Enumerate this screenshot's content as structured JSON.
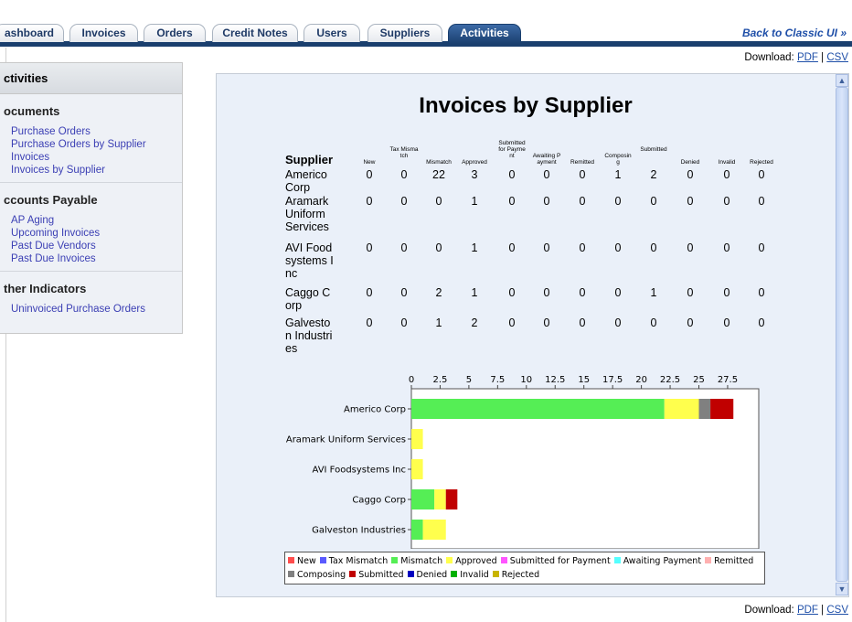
{
  "tabs": [
    {
      "label": "ashboard",
      "active": false
    },
    {
      "label": "Invoices",
      "active": false
    },
    {
      "label": "Orders",
      "active": false
    },
    {
      "label": "Credit Notes",
      "active": false
    },
    {
      "label": "Users",
      "active": false
    },
    {
      "label": "Suppliers",
      "active": false
    },
    {
      "label": "Activities",
      "active": true
    }
  ],
  "classic_link": "Back to Classic UI »",
  "download": {
    "label": "Download:",
    "pdf": "PDF",
    "separator": "|",
    "csv": "CSV"
  },
  "sidebar": {
    "header": "ctivities",
    "sections": [
      {
        "title": "ocuments",
        "links": [
          "Purchase Orders",
          "Purchase Orders by Supplier",
          "Invoices",
          "Invoices by Supplier"
        ]
      },
      {
        "title": "ccounts Payable",
        "links": [
          "AP Aging",
          "Upcoming Invoices",
          "Past Due Vendors",
          "Past Due Invoices"
        ]
      },
      {
        "title": "ther Indicators",
        "links": [
          "Uninvoiced Purchase Orders"
        ]
      }
    ]
  },
  "report": {
    "title": "Invoices by Supplier",
    "supplier_header": "Supplier",
    "columns": [
      "New",
      "Tax Mismatch",
      "Mismatch",
      "Approved",
      "Submitted for Payment",
      "Awaiting Payment",
      "Remitted",
      "Composing",
      "Submitted",
      "Denied",
      "Invalid",
      "Rejected"
    ],
    "rows": [
      {
        "supplier": "Americo Corp",
        "values": [
          0,
          0,
          22,
          3,
          0,
          0,
          0,
          1,
          2,
          0,
          0,
          0
        ]
      },
      {
        "supplier": "Aramark Uniform Services",
        "values": [
          0,
          0,
          0,
          1,
          0,
          0,
          0,
          0,
          0,
          0,
          0,
          0
        ]
      },
      {
        "supplier": "AVI Foodsystems Inc",
        "values": [
          0,
          0,
          0,
          1,
          0,
          0,
          0,
          0,
          0,
          0,
          0,
          0
        ]
      },
      {
        "supplier": "Caggo Corp",
        "values": [
          0,
          0,
          2,
          1,
          0,
          0,
          0,
          0,
          1,
          0,
          0,
          0
        ]
      },
      {
        "supplier": "Galveston Industries",
        "values": [
          0,
          0,
          1,
          2,
          0,
          0,
          0,
          0,
          0,
          0,
          0,
          0
        ]
      }
    ]
  },
  "chart_data": {
    "type": "bar",
    "orientation": "horizontal",
    "stacked": true,
    "categories": [
      "Americo Corp",
      "Aramark Uniform Services",
      "AVI Foodsystems Inc",
      "Caggo Corp",
      "Galveston Industries"
    ],
    "series": [
      {
        "name": "New",
        "color": "#ff4d4d",
        "values": [
          0,
          0,
          0,
          0,
          0
        ]
      },
      {
        "name": "Tax Mismatch",
        "color": "#5a5aff",
        "values": [
          0,
          0,
          0,
          0,
          0
        ]
      },
      {
        "name": "Mismatch",
        "color": "#55ee55",
        "values": [
          22,
          0,
          0,
          2,
          1
        ]
      },
      {
        "name": "Approved",
        "color": "#ffff4d",
        "values": [
          3,
          1,
          1,
          1,
          2
        ]
      },
      {
        "name": "Submitted for Payment",
        "color": "#ff55ff",
        "values": [
          0,
          0,
          0,
          0,
          0
        ]
      },
      {
        "name": "Awaiting Payment",
        "color": "#55ffff",
        "values": [
          0,
          0,
          0,
          0,
          0
        ]
      },
      {
        "name": "Remitted",
        "color": "#ffb0b0",
        "values": [
          0,
          0,
          0,
          0,
          0
        ]
      },
      {
        "name": "Composing",
        "color": "#808080",
        "values": [
          1,
          0,
          0,
          0,
          0
        ]
      },
      {
        "name": "Submitted",
        "color": "#c00000",
        "values": [
          2,
          0,
          0,
          1,
          0
        ]
      },
      {
        "name": "Denied",
        "color": "#0000c0",
        "values": [
          0,
          0,
          0,
          0,
          0
        ]
      },
      {
        "name": "Invalid",
        "color": "#00b000",
        "values": [
          0,
          0,
          0,
          0,
          0
        ]
      },
      {
        "name": "Rejected",
        "color": "#c8b400",
        "values": [
          0,
          0,
          0,
          0,
          0
        ]
      }
    ],
    "x_ticks": [
      "0",
      "2.5",
      "5",
      "7.5",
      "10",
      "12.5",
      "15",
      "17.5",
      "20",
      "22.5",
      "25",
      "27.5"
    ],
    "xlim": [
      0,
      30
    ],
    "legend_position": "bottom",
    "grid": false
  }
}
